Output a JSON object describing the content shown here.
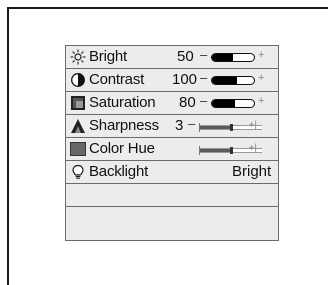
{
  "menu": {
    "items": [
      {
        "icon": "brightness-sun-icon",
        "label": "Bright",
        "value": "50",
        "control": "pill",
        "level": 0.5,
        "minus": "–",
        "plus": "+"
      },
      {
        "icon": "contrast-icon",
        "label": "Contrast",
        "value": "100",
        "control": "pill",
        "level": 0.6,
        "minus": "–",
        "plus": "+"
      },
      {
        "icon": "saturation-icon",
        "label": "Saturation",
        "value": "80",
        "control": "pill",
        "level": 0.55,
        "minus": "–",
        "plus": "+"
      },
      {
        "icon": "sharpness-icon",
        "label": "Sharpness",
        "value": "3",
        "control": "thin",
        "level": 0.5,
        "minus": "–",
        "plus": "+|"
      },
      {
        "icon": "color-hue-icon",
        "label": "Color Hue",
        "value": "",
        "control": "thin",
        "level": 0.5,
        "minus": "",
        "plus": "+|"
      },
      {
        "icon": "backlight-bulb-icon",
        "label": "Backlight",
        "value": "Bright",
        "control": "none"
      }
    ]
  }
}
